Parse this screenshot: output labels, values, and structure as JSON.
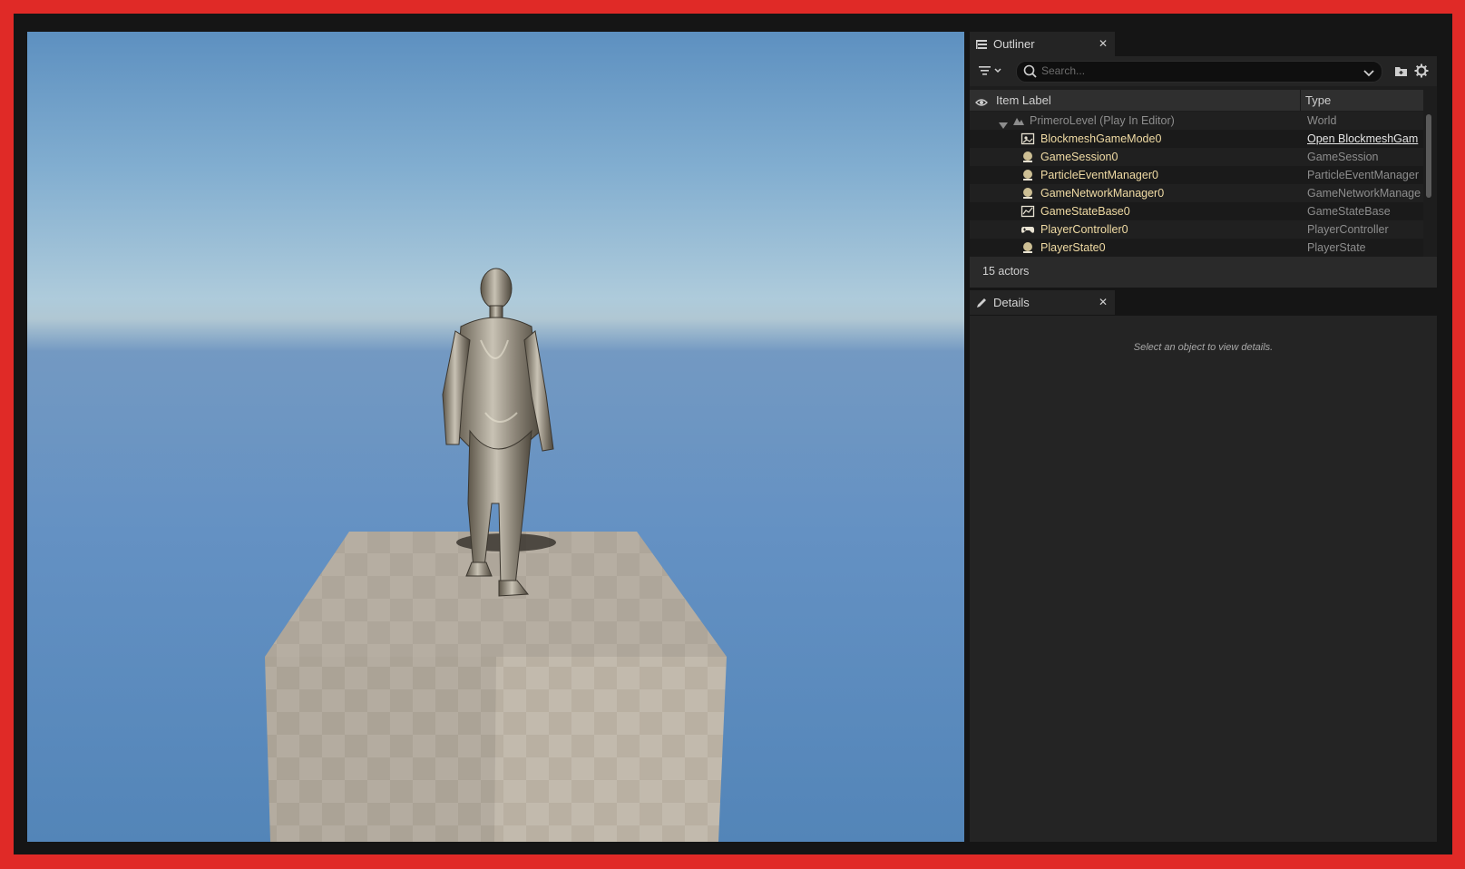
{
  "outliner": {
    "tab_title": "Outliner",
    "search_placeholder": "Search...",
    "columns": {
      "label": "Item Label",
      "type": "Type"
    },
    "rows": [
      {
        "label": "PrimeroLevel (Play In Editor)",
        "type": "World",
        "icon": "world-icon"
      },
      {
        "label": "BlockmeshGameMode0",
        "type": "Open BlockmeshGam",
        "icon": "game-mode-icon"
      },
      {
        "label": "GameSession0",
        "type": "GameSession",
        "icon": "actor-icon"
      },
      {
        "label": "ParticleEventManager0",
        "type": "ParticleEventManager",
        "icon": "actor-icon"
      },
      {
        "label": "GameNetworkManager0",
        "type": "GameNetworkManage",
        "icon": "actor-icon"
      },
      {
        "label": "GameStateBase0",
        "type": "GameStateBase",
        "icon": "game-state-icon"
      },
      {
        "label": "PlayerController0",
        "type": "PlayerController",
        "icon": "gamepad-icon"
      },
      {
        "label": "PlayerState0",
        "type": "PlayerState",
        "icon": "actor-icon"
      }
    ],
    "actor_count": "15 actors"
  },
  "details": {
    "tab_title": "Details",
    "empty_message": "Select an object to view details."
  },
  "colors": {
    "frame_border": "#e02a27",
    "panel_bg": "#242424",
    "actor_label": "#f0dba4",
    "type_text": "#8d8d8d"
  }
}
